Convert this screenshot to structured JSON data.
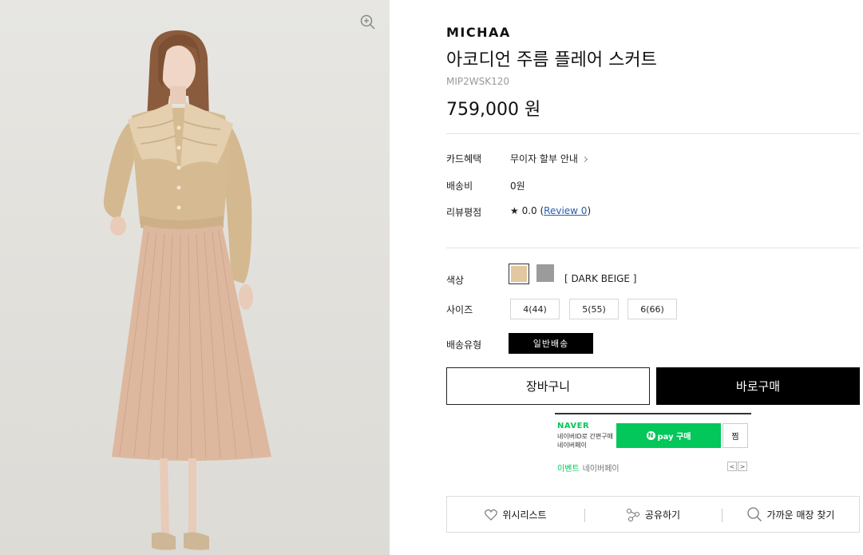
{
  "product": {
    "brand": "MICHAA",
    "name": "아코디언 주름 플레어 스커트",
    "sku": "MIP2WSK120",
    "price": "759,000 원"
  },
  "info_rows": {
    "card_label": "카드혜택",
    "card_value": "무이자 할부 안내",
    "shipping_fee_label": "배송비",
    "shipping_fee_value": "0원",
    "rating_label": "리뷰평점",
    "rating_value": "★ 0.0",
    "review_open": "(",
    "review_link": "Review 0",
    "review_close": ")"
  },
  "options": {
    "color_label": "색상",
    "colors": [
      {
        "name": "DARK BEIGE",
        "hex": "#e1c89f"
      },
      {
        "name": "GRAY",
        "hex": "#9b9b9b"
      }
    ],
    "selected_color_text": "[ DARK BEIGE ]",
    "size_label": "사이즈",
    "sizes": [
      "4(44)",
      "5(55)",
      "6(66)"
    ],
    "delivery_label": "배송유형",
    "delivery_option": "일반배송"
  },
  "buttons": {
    "cart": "장바구니",
    "buy": "바로구매"
  },
  "naver_pay": {
    "logo": "NAVER",
    "desc_line1": "네이버ID로 간편구매",
    "desc_line2": "네이버페이",
    "pay_n": "N",
    "pay_label": "pay 구매",
    "zzim": "찜",
    "event_label": "이벤트",
    "event_text": "네이버페이",
    "prev": "<",
    "next": ">",
    "brand_color": "#03c75a"
  },
  "actions": {
    "wishlist": "위시리스트",
    "share": "공유하기",
    "store": "가까운 매장 찾기"
  },
  "icons": {
    "zoom": "zoom-in-icon",
    "wishlist": "heart-icon",
    "share": "share-icon",
    "store": "search-icon"
  }
}
